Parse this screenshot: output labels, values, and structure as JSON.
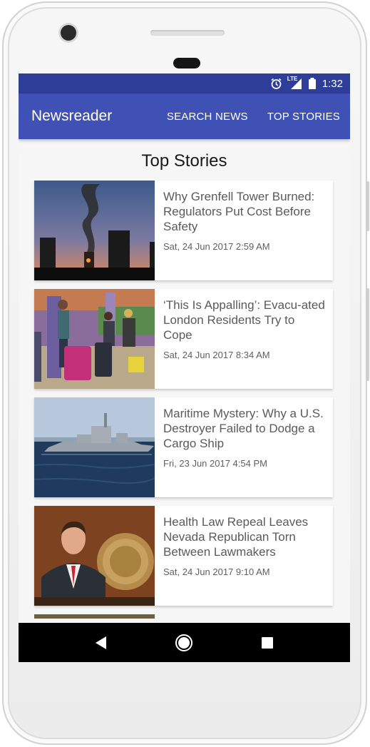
{
  "status": {
    "time": "1:32",
    "network": "LTE",
    "alarm_icon": "alarm-icon",
    "signal_icon": "signal-icon",
    "battery_icon": "battery-icon"
  },
  "appbar": {
    "title": "Newsreader",
    "search_label": "SEARCH NEWS",
    "top_stories_label": "TOP STORIES"
  },
  "section": {
    "title": "Top Stories"
  },
  "articles": [
    {
      "title": "Why Grenfell Tower Burned: Regulators Put Cost Before Safety",
      "date": "Sat, 24 Jun 2017 2:59 AM"
    },
    {
      "title": "‘This Is Appalling’: Evacu-ated London Residents Try to Cope",
      "date": "Sat, 24 Jun 2017 8:34 AM"
    },
    {
      "title": "Maritime Mystery: Why a U.S. Destroyer Failed to Dodge a Cargo Ship",
      "date": "Fri, 23 Jun 2017 4:54 PM"
    },
    {
      "title": "Health Law Repeal Leaves Nevada Republican Torn Between Lawmakers",
      "date": "Sat, 24 Jun 2017 9:10 AM"
    }
  ],
  "colors": {
    "primary": "#3f51b5",
    "primary_dark": "#2e3d98"
  }
}
